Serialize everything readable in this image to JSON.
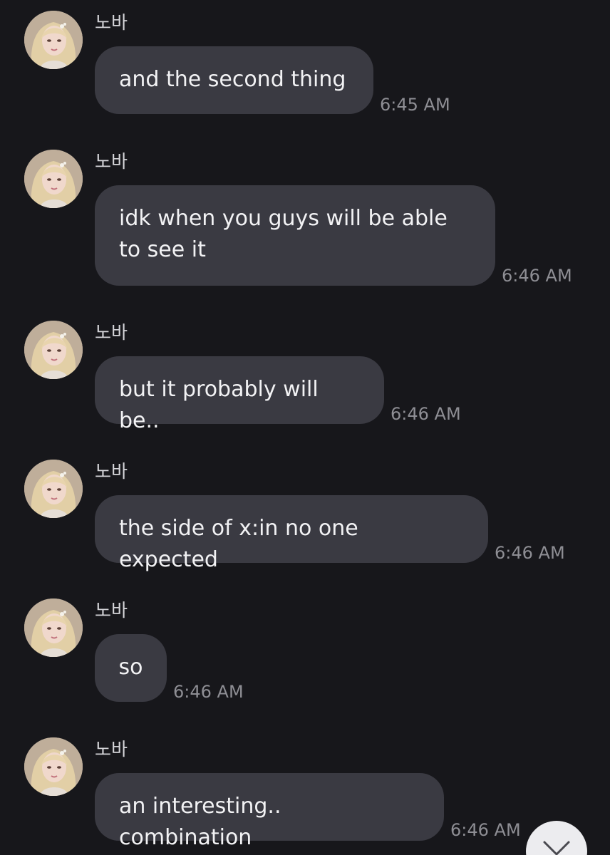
{
  "sender_name": "노바",
  "messages": [
    {
      "text": "and the second thing",
      "time": "6:45 AM"
    },
    {
      "text": "idk when you guys will be able to see it",
      "time": "6:46 AM"
    },
    {
      "text": "but it probably will be..",
      "time": "6:46 AM"
    },
    {
      "text": "the side of x:in no one expected",
      "time": "6:46 AM"
    },
    {
      "text": "so",
      "time": "6:46 AM"
    },
    {
      "text": "an interesting.. combination",
      "time": "6:46 AM"
    }
  ],
  "scroll_button": {
    "icon": "chevron-down-icon"
  },
  "colors": {
    "background": "#17171b",
    "bubble": "#3a3a42",
    "text": "#f2f2f4",
    "timestamp": "#8e8e94"
  }
}
